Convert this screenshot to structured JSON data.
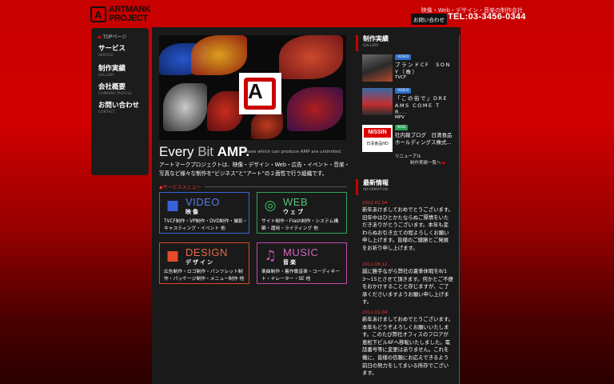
{
  "header": {
    "logo_mark": "A",
    "logo_line1": "ARTMARK",
    "logo_line2": "PROJECT",
    "tagline": "映像・Web・デザイン・音楽の制作会社",
    "contact_label": "お問い合わせ",
    "phone": "TEL:03-3456-0344"
  },
  "nav": {
    "home": "TOPページ",
    "items": [
      {
        "label": "サービス",
        "sub": "SERVICE"
      },
      {
        "label": "制作実績",
        "sub": "GALLERY"
      },
      {
        "label": "会社概要",
        "sub": "COMPANY PROFILE"
      },
      {
        "label": "お問い合わせ",
        "sub": "CONTACT"
      }
    ]
  },
  "hero": {
    "logo_letter": "A"
  },
  "tagline_block": {
    "every": "Every ",
    "bit": "Bit ",
    "amp": "AMP.",
    "sub": "Those which can produce AMP are unlimited.",
    "intro": "アートマークプロジェクトは、映像・デザイン・Web・広告・イベント・音楽・写真など様々な制作を“ビジネス”と“アート”の２面性で行う組織です。"
  },
  "services": {
    "heading": "サービスメニュー",
    "items": [
      {
        "en": "VIDEO",
        "jp": "映像",
        "desc": "TVCF制作・VP制作・DVD制作・撮影・キャスティング・イベント 他",
        "color": "#3b63d8",
        "icon": "video-camera-icon"
      },
      {
        "en": "WEB",
        "jp": "ウェブ",
        "desc": "サイト制作・Flash制作・システム構築・運用・ライティング 他",
        "color": "#2fa35a",
        "icon": "globe-icon"
      },
      {
        "en": "DESIGN",
        "jp": "デザイン",
        "desc": "広告制作・ロゴ制作・パンフレット制作・パッケージ制作・メニュー制作 他",
        "color": "#d84a2a",
        "icon": "shapes-icon"
      },
      {
        "en": "MUSIC",
        "jp": "音楽",
        "desc": "楽曲制作・着作歌音楽・コーディネート・ナレーター・SE 他",
        "color": "#c04aa8",
        "icon": "music-note-icon"
      }
    ]
  },
  "gallery": {
    "title": "制作実績",
    "sub": "GALLERY",
    "items": [
      {
        "badge": "VIDEO",
        "badge_color": "#2b6fc9",
        "title": "ブランドCF　SONY（株）",
        "client": "TVCF"
      },
      {
        "badge": "VIDEO",
        "badge_color": "#2b6fc9",
        "title": "「この街で」DREAMS COME TR...",
        "client": "MPV"
      },
      {
        "badge": "WEB",
        "badge_color": "#2aa052",
        "title": "社内報ブログ　日清食品ホールディングス株式...",
        "client": "リニューアル"
      }
    ],
    "thumb_brand": "NISSIN",
    "thumb_brand_sub": "日清食品HD",
    "more": "制作実績一覧へ"
  },
  "news": {
    "title": "最新情報",
    "sub": "INFORMATION",
    "items": [
      {
        "date": "2012.01.04",
        "text": "新年あけましておめでとうございます。旧年中はひとかたならぬご厚情をいただきありがとうございます。本年も変わらぬお引き立ての程よろしくお願い申し上げます。皆様のご健勝とご発展をお祈り申し上げます。"
      },
      {
        "date": "2011.08.12",
        "text": "誠に勝手ながら弊社の夏季休暇を8/13〜15とさせて頂きます。何かとご不便をおかけすることと存じますが、ご了承くださいますようお願い申し上げます。"
      },
      {
        "date": "2011.01.04",
        "text": "新年あけましておめでとうございます。本年もどうぞよろしくお願いいたします。このたび弊社オフィスのフロアが恵松下ビル6Fへ移転いたしました。電話番号等に変更はありません。これを機に、皆様の信頼にお応えできるよう前日の努力をしてまいる所存でございます。"
      }
    ]
  }
}
